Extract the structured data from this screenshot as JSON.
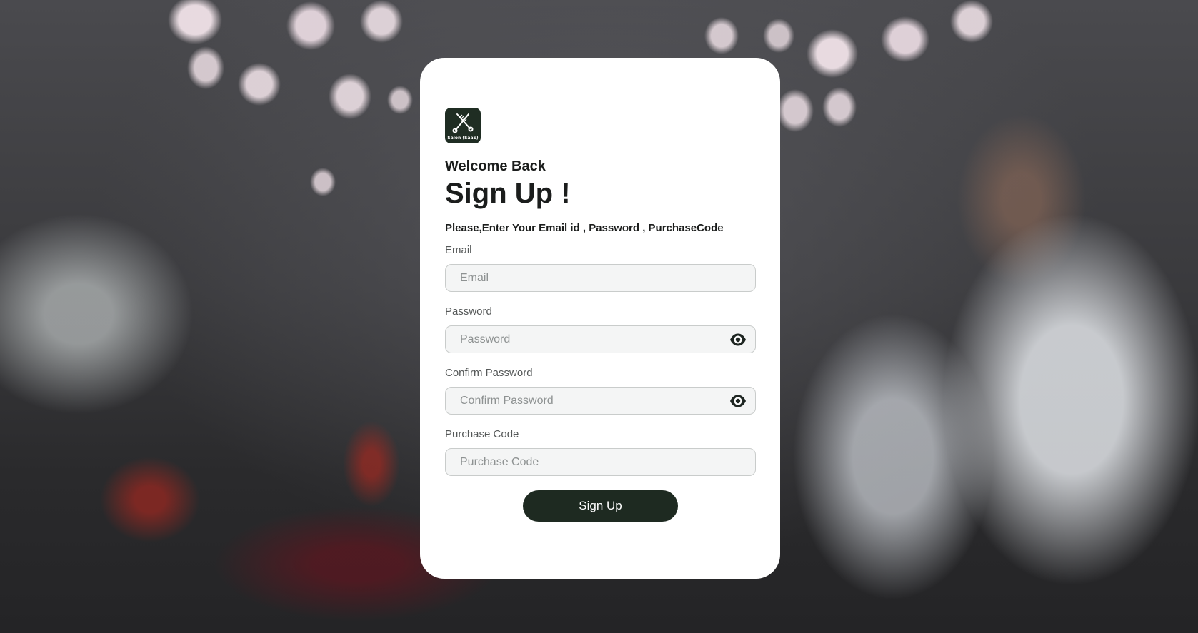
{
  "brand": {
    "logo_text": "Salon (SaaS)",
    "logo_icon": "scissors-comb-icon",
    "logo_bg": "#1f2d23"
  },
  "header": {
    "welcome": "Welcome Back",
    "title": "Sign Up !",
    "subtitle": "Please,Enter Your Email id , Password , PurchaseCode"
  },
  "form": {
    "email": {
      "label": "Email",
      "placeholder": "Email",
      "value": ""
    },
    "password": {
      "label": "Password",
      "placeholder": "Password",
      "value": "",
      "icon": "eye-icon"
    },
    "confirm_password": {
      "label": "Confirm Password",
      "placeholder": "Confirm Password",
      "value": "",
      "icon": "eye-icon"
    },
    "purchase_code": {
      "label": "Purchase Code",
      "placeholder": "Purchase Code",
      "value": ""
    },
    "submit_label": "Sign Up"
  },
  "colors": {
    "primary": "#1e2a21",
    "card_bg": "#ffffff",
    "input_bg": "#f4f5f5",
    "input_border": "#c9cccb"
  }
}
